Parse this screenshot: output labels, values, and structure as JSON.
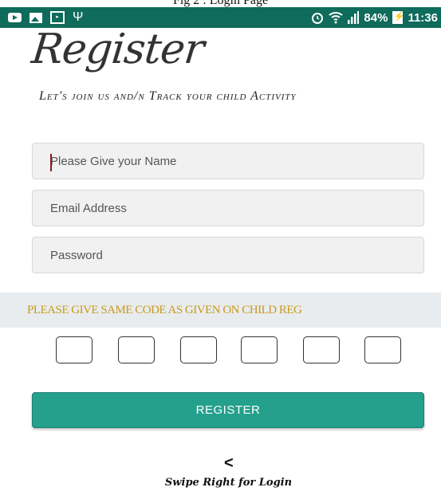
{
  "caption": "Fig 2 : Login Page",
  "status_bar": {
    "left_icons": [
      "youtube-icon",
      "gallery-icon",
      "video-icon",
      "usb-icon"
    ],
    "alarm_icon": "alarm-icon",
    "wifi_icon": "wifi-icon",
    "signal_icon": "signal-icon",
    "battery_percent": "84%",
    "time": "11:36",
    "background": "#0f6b5b"
  },
  "title": "Register",
  "tagline": "Let's join us and/n Track your child Activity",
  "form": {
    "name_placeholder": "Please Give your Name",
    "email_placeholder": "Email Address",
    "password_placeholder": "Password"
  },
  "code_section": {
    "instruction": "PLEASE GIVE SAME CODE AS GIVEN ON CHILD REG",
    "box_count": 6,
    "instruction_color": "#c99a1a"
  },
  "register_button": {
    "label": "REGISTER",
    "color": "#24a08d"
  },
  "footer": {
    "back_glyph": "<",
    "swipe_text": "Swipe Right for Login"
  }
}
